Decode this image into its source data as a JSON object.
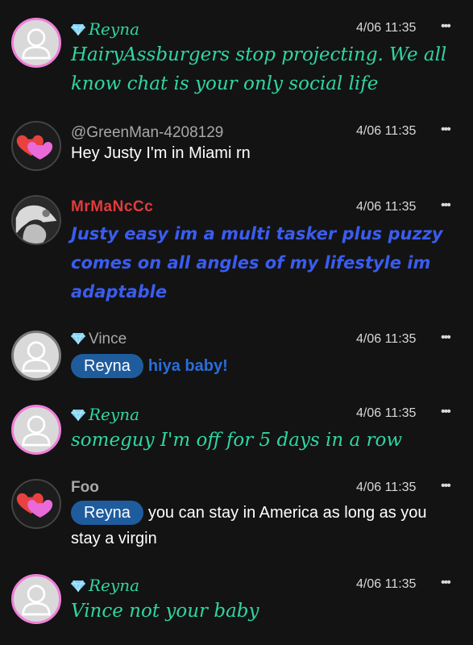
{
  "messages": [
    {
      "name": "Reyna",
      "time": "4/06 11:35",
      "body": "HairyAssburgers stop projecting. We all know chat is your only social life"
    },
    {
      "name": "@GreenMan-4208129",
      "time": "4/06 11:35",
      "body": "Hey Justy I'm in Miami rn"
    },
    {
      "name": "MrMaNcCc",
      "time": "4/06 11:35",
      "body": "Justy easy im a multi tasker plus puzzy comes on all angles of my lifestyle im adaptable"
    },
    {
      "name": "Vince",
      "time": "4/06 11:35",
      "mention": "Reyna",
      "body": "hiya baby!"
    },
    {
      "name": "Reyna",
      "time": "4/06 11:35",
      "body": "someguy I'm off for 5 days in a row"
    },
    {
      "name": "Foo",
      "time": "4/06 11:35",
      "mention": "Reyna",
      "body": "you can stay in America as long as you stay a virgin"
    },
    {
      "name": "Reyna",
      "time": "4/06 11:35",
      "body": "Vince not your baby"
    }
  ],
  "more_icon": "more-horizontal-icon",
  "gem_icon": "diamond-icon",
  "colors": {
    "background": "#131313",
    "script_green": "#2fd6a2",
    "mention_bg": "#1f5c9e",
    "blue_text": "#3a5cf0",
    "red_name": "#e23b3b",
    "pink_ring": "#f07fd9"
  }
}
